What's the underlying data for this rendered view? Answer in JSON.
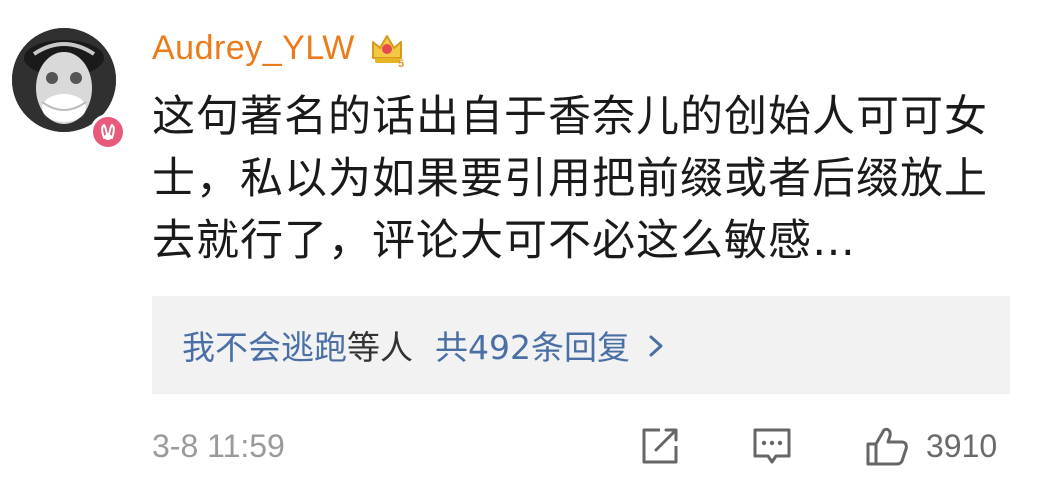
{
  "comment": {
    "username": "Audrey_YLW",
    "text": "这句著名的话出自于香奈儿的创始人可可女士，私以为如果要引用把前缀或者后缀放上去就行了，评论大可不必这么敏感…",
    "reply_preview": {
      "user": "我不会逃跑",
      "mid": "等人",
      "count_label": "共492条回复"
    },
    "timestamp": "3-8 11:59",
    "like_count": "3910"
  },
  "colors": {
    "username": "#eb7b1a",
    "link": "#4a6fa5",
    "badge": "#e8597c",
    "vip_gold": "#e6b422",
    "meta_gray": "#9a9a9a"
  },
  "icons": {
    "vip": "vip-crown-icon",
    "badge": "rabbit-badge-icon",
    "chevron": "chevron-right-icon",
    "forward": "forward-icon",
    "comment": "comment-icon",
    "like": "thumbs-up-icon"
  }
}
